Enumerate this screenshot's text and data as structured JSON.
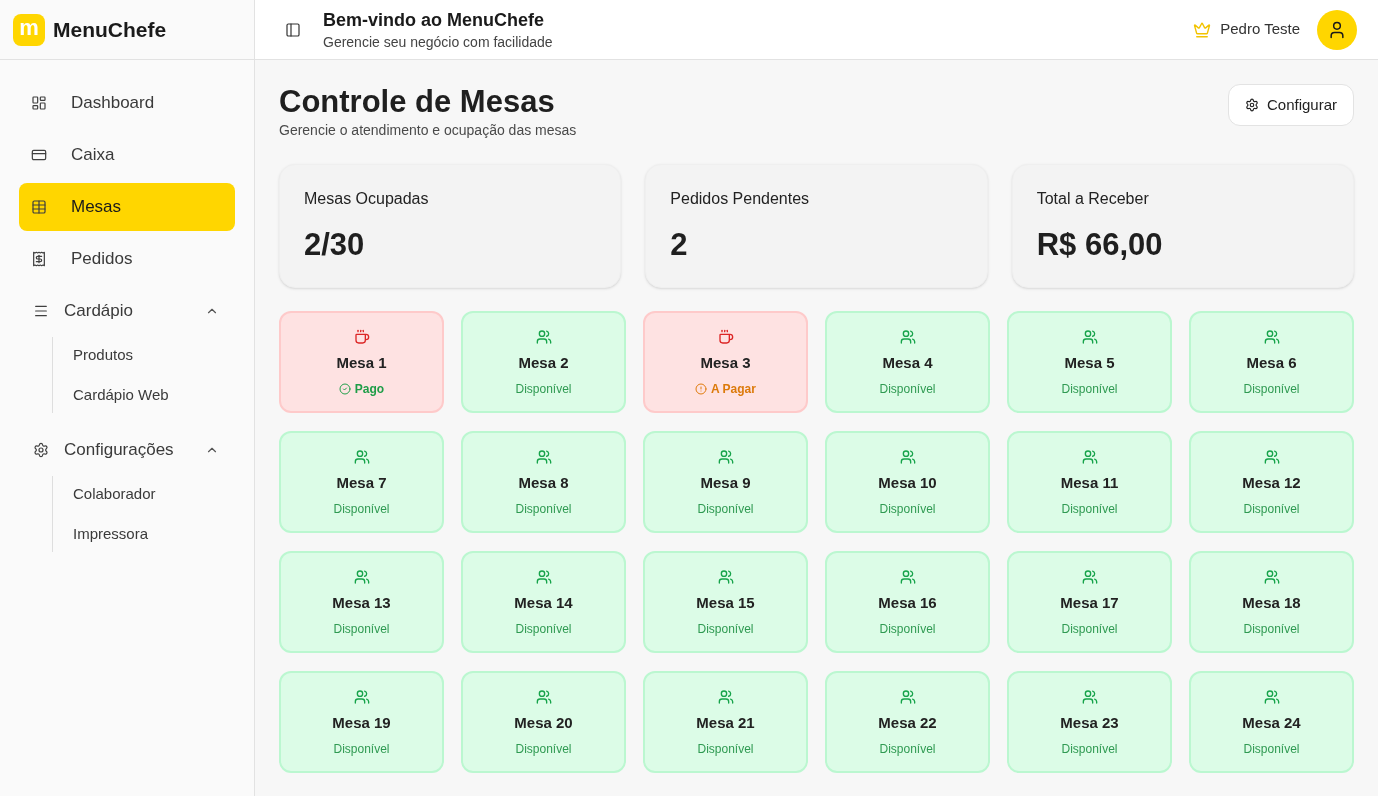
{
  "sidebar": {
    "brand": {
      "logo_letter": "m",
      "name": "MenuChefe"
    },
    "items": [
      {
        "kind": "link",
        "label": "Dashboard",
        "selected": false
      },
      {
        "kind": "link",
        "label": "Caixa",
        "selected": false
      },
      {
        "kind": "link",
        "label": "Mesas",
        "selected": true
      },
      {
        "kind": "link",
        "label": "Pedidos",
        "selected": false
      },
      {
        "kind": "group",
        "label": "Cardápio",
        "expanded": true,
        "children": [
          {
            "label": "Produtos",
            "selected": false
          },
          {
            "label": "Cardápio Web",
            "selected": false
          }
        ]
      },
      {
        "kind": "group",
        "label": "Configurações",
        "expanded": true,
        "children": [
          {
            "label": "Colaborador",
            "selected": false
          },
          {
            "label": "Impressora",
            "selected": false
          }
        ]
      }
    ]
  },
  "header": {
    "title": "Bem-vindo ao MenuChefe",
    "subtitle": "Gerencie seu negócio com facilidade",
    "user_name": "Pedro Teste"
  },
  "page": {
    "title": "Controle de Mesas",
    "subtitle": "Gerencie o atendimento e ocupação das mesas",
    "action": "Configurar"
  },
  "stats": [
    {
      "label": "Mesas Ocupadas",
      "value": "2/30"
    },
    {
      "label": "Pedidos Pendentes",
      "value": "2"
    },
    {
      "label": "Total a Receber",
      "value": "R$ 66,00"
    }
  ],
  "tables": [
    {
      "name": "Mesa 1",
      "occupied": true,
      "status": {
        "kind": "paid",
        "label": "Pago"
      }
    },
    {
      "name": "Mesa 2",
      "occupied": false,
      "status": {
        "kind": "available",
        "label": "Disponível"
      }
    },
    {
      "name": "Mesa 3",
      "occupied": true,
      "status": {
        "kind": "unpaid",
        "label": "A Pagar"
      }
    },
    {
      "name": "Mesa 4",
      "occupied": false,
      "status": {
        "kind": "available",
        "label": "Disponível"
      }
    },
    {
      "name": "Mesa 5",
      "occupied": false,
      "status": {
        "kind": "available",
        "label": "Disponível"
      }
    },
    {
      "name": "Mesa 6",
      "occupied": false,
      "status": {
        "kind": "available",
        "label": "Disponível"
      }
    },
    {
      "name": "Mesa 7",
      "occupied": false,
      "status": {
        "kind": "available",
        "label": "Disponível"
      }
    },
    {
      "name": "Mesa 8",
      "occupied": false,
      "status": {
        "kind": "available",
        "label": "Disponível"
      }
    },
    {
      "name": "Mesa 9",
      "occupied": false,
      "status": {
        "kind": "available",
        "label": "Disponível"
      }
    },
    {
      "name": "Mesa 10",
      "occupied": false,
      "status": {
        "kind": "available",
        "label": "Disponível"
      }
    },
    {
      "name": "Mesa 11",
      "occupied": false,
      "status": {
        "kind": "available",
        "label": "Disponível"
      }
    },
    {
      "name": "Mesa 12",
      "occupied": false,
      "status": {
        "kind": "available",
        "label": "Disponível"
      }
    },
    {
      "name": "Mesa 13",
      "occupied": false,
      "status": {
        "kind": "available",
        "label": "Disponível"
      }
    },
    {
      "name": "Mesa 14",
      "occupied": false,
      "status": {
        "kind": "available",
        "label": "Disponível"
      }
    },
    {
      "name": "Mesa 15",
      "occupied": false,
      "status": {
        "kind": "available",
        "label": "Disponível"
      }
    },
    {
      "name": "Mesa 16",
      "occupied": false,
      "status": {
        "kind": "available",
        "label": "Disponível"
      }
    },
    {
      "name": "Mesa 17",
      "occupied": false,
      "status": {
        "kind": "available",
        "label": "Disponível"
      }
    },
    {
      "name": "Mesa 18",
      "occupied": false,
      "status": {
        "kind": "available",
        "label": "Disponível"
      }
    },
    {
      "name": "Mesa 19",
      "occupied": false,
      "status": {
        "kind": "available",
        "label": "Disponível"
      }
    },
    {
      "name": "Mesa 20",
      "occupied": false,
      "status": {
        "kind": "available",
        "label": "Disponível"
      }
    },
    {
      "name": "Mesa 21",
      "occupied": false,
      "status": {
        "kind": "available",
        "label": "Disponível"
      }
    },
    {
      "name": "Mesa 22",
      "occupied": false,
      "status": {
        "kind": "available",
        "label": "Disponível"
      }
    },
    {
      "name": "Mesa 23",
      "occupied": false,
      "status": {
        "kind": "available",
        "label": "Disponível"
      }
    },
    {
      "name": "Mesa 24",
      "occupied": false,
      "status": {
        "kind": "available",
        "label": "Disponível"
      }
    }
  ]
}
